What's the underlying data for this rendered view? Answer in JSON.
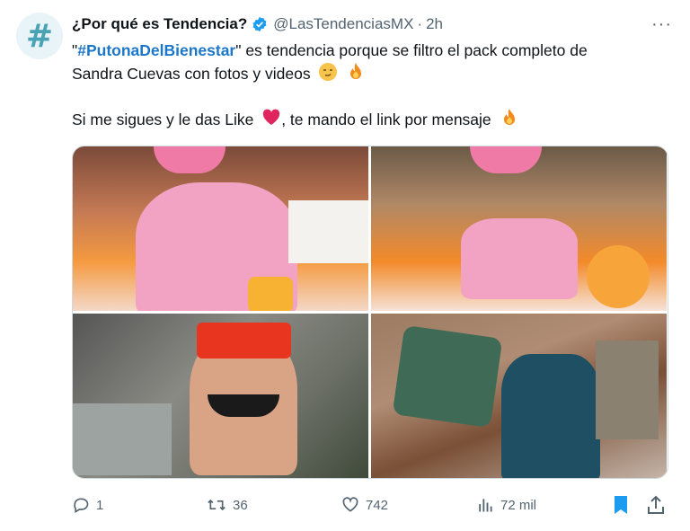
{
  "tweet": {
    "author": "¿Por qué es Tendencia?",
    "handle": "@LasTendenciasMX",
    "separator": "·",
    "time": "2h",
    "more_label": "···",
    "text": {
      "line1_quote_open": "\"",
      "hashtag": "#PutonaDelBienestar",
      "line1_rest": "\" es tendencia porque se filtro el pack completo de",
      "line2": "Sandra Cuevas con fotos y videos",
      "line3": "Si me sigues y le das Like",
      "line3_rest": ", te mando el link por mensaje"
    },
    "stats": {
      "replies": "1",
      "retweets": "36",
      "likes": "742",
      "views": "72 mil"
    }
  },
  "colors": {
    "accent": "#1d77c9",
    "muted": "#536471",
    "verified": "#1d9bf0",
    "bookmark": "#1d9bf0",
    "heart_emoji": "#e0245e"
  },
  "icons": {
    "avatar": "hash-logo-icon",
    "verified": "verified-badge-icon",
    "reply": "reply-icon",
    "retweet": "retweet-icon",
    "like": "like-icon",
    "views": "views-chart-icon",
    "bookmark": "bookmark-icon",
    "share": "share-icon"
  }
}
